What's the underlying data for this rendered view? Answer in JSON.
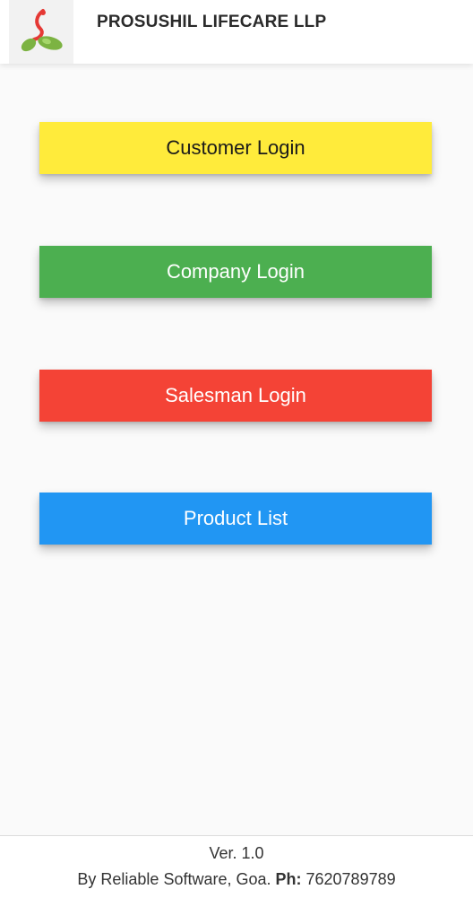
{
  "header": {
    "title": "PROSUSHIL LIFECARE LLP",
    "logo_icon": "capsule-logo-icon",
    "colors": {
      "logo_green": "#7cb342",
      "logo_red": "#e53935"
    }
  },
  "menu": {
    "customer_login": {
      "label": "Customer Login",
      "color": "#ffeb3b"
    },
    "company_login": {
      "label": "Company Login",
      "color": "#4caf50"
    },
    "salesman_login": {
      "label": "Salesman Login",
      "color": "#f44336"
    },
    "product_list": {
      "label": "Product List",
      "color": "#2196f3"
    }
  },
  "footer": {
    "version": "Ver. 1.0",
    "credit_prefix": "By Reliable Software, Goa. ",
    "phone_label": "Ph:",
    "phone_number": " 7620789789"
  }
}
